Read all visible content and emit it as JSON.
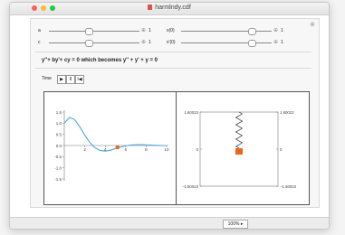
{
  "window": {
    "title": "harmlndy.cdf"
  },
  "controls": {
    "a": {
      "label": "a",
      "value": "1",
      "fraction": 0.45
    },
    "b": {
      "label": "c",
      "value": "1",
      "fraction": 0.45
    },
    "x0": {
      "label": "x(0)",
      "value": "1",
      "fraction": 0.75
    },
    "v0": {
      "label": "x'(0)",
      "value": "1",
      "fraction": 0.75
    },
    "plus_glyph": "⊕"
  },
  "equation": "y''+ by'+ cy = 0 which becomes  y'' + y' + y = 0",
  "time": {
    "label": "Time",
    "play": "▶",
    "pause": "II",
    "reset": "I◀"
  },
  "chart_data": [
    {
      "type": "line",
      "x_ticks": [
        "2",
        "4",
        "6",
        "8",
        "10"
      ],
      "y_ticks": [
        "1.5",
        "1.0",
        "0.5",
        "0.0",
        "-0.5",
        "-1.0",
        "-1.5"
      ],
      "xlim": [
        0,
        10
      ],
      "ylim": [
        -1.5,
        1.5
      ],
      "series": [
        {
          "x": [
            0,
            0.5,
            1,
            1.5,
            2,
            2.5,
            3,
            3.5,
            4,
            4.5,
            5,
            5.5,
            6,
            6.5,
            7,
            7.5,
            8,
            8.5,
            9,
            9.5,
            10
          ],
          "y": [
            1.0,
            1.26,
            1.17,
            0.85,
            0.47,
            0.13,
            -0.1,
            -0.22,
            -0.25,
            -0.21,
            -0.14,
            -0.07,
            -0.01,
            0.02,
            0.04,
            0.04,
            0.03,
            0.02,
            0.01,
            0.0,
            0.0
          ]
        }
      ],
      "marker": {
        "x": 5.2,
        "y": -0.08
      },
      "color": "#48a9dc",
      "marker_color": "#e8661a"
    },
    {
      "type": "spring",
      "y_ticks_left": [
        "1.60023",
        "0",
        "−1.60023"
      ],
      "y_ticks_right": [
        "1.60023",
        "0",
        "−1.60023"
      ],
      "mass_position": -0.08,
      "ylim": [
        -1.60023,
        1.60023
      ],
      "mass_color": "#e8661a"
    }
  ],
  "statusbar": {
    "zoom": "100% ▸"
  }
}
